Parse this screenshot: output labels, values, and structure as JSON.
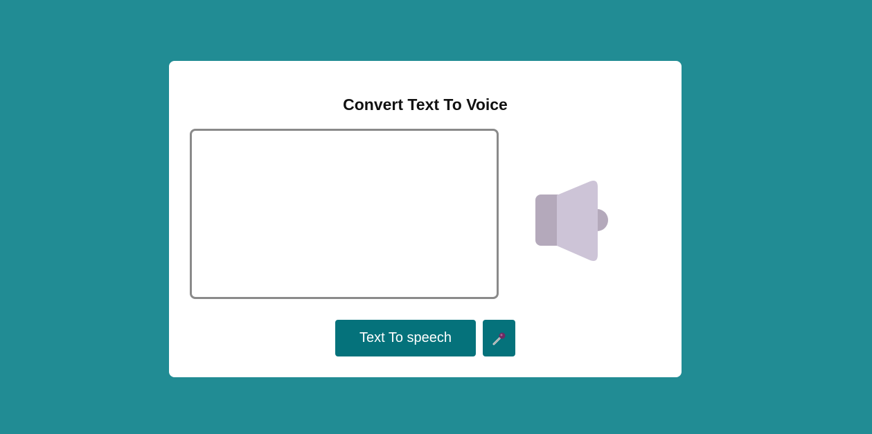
{
  "card": {
    "title": "Convert Text To Voice"
  },
  "text_input": {
    "value": "",
    "placeholder": ""
  },
  "buttons": {
    "tts_label": "Text To speech",
    "mic_icon": "microphone-icon"
  },
  "speaker": {
    "icon": "speaker-icon",
    "colors": {
      "body": "#b4a9bb",
      "cone": "#cdc4d7"
    }
  },
  "colors": {
    "background": "#218c94",
    "card": "#ffffff",
    "button": "#05727b",
    "textarea_border": "#8a8a8a"
  }
}
